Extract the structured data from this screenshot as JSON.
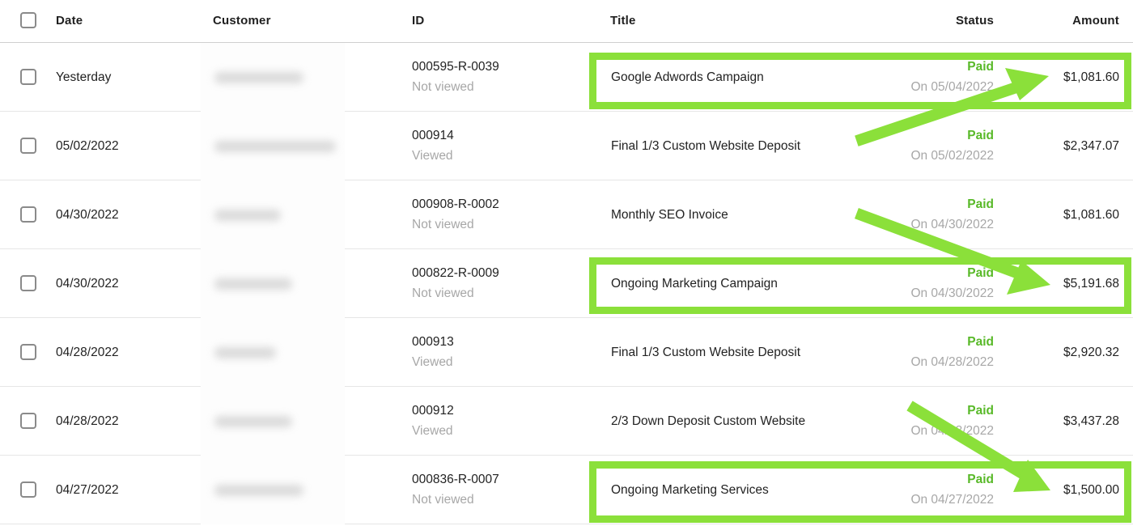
{
  "header": {
    "date": "Date",
    "customer": "Customer",
    "id": "ID",
    "title": "Title",
    "status": "Status",
    "amount": "Amount"
  },
  "rows": [
    {
      "date": "Yesterday",
      "id": "000595-R-0039",
      "viewed": "Not viewed",
      "title": "Google Adwords Campaign",
      "status": "Paid",
      "status_date": "On 05/04/2022",
      "amount": "$1,081.60"
    },
    {
      "date": "05/02/2022",
      "id": "000914",
      "viewed": "Viewed",
      "title": "Final 1/3 Custom Website Deposit",
      "status": "Paid",
      "status_date": "On 05/02/2022",
      "amount": "$2,347.07"
    },
    {
      "date": "04/30/2022",
      "id": "000908-R-0002",
      "viewed": "Not viewed",
      "title": "Monthly SEO Invoice",
      "status": "Paid",
      "status_date": "On 04/30/2022",
      "amount": "$1,081.60"
    },
    {
      "date": "04/30/2022",
      "id": "000822-R-0009",
      "viewed": "Not viewed",
      "title": "Ongoing Marketing Campaign",
      "status": "Paid",
      "status_date": "On 04/30/2022",
      "amount": "$5,191.68"
    },
    {
      "date": "04/28/2022",
      "id": "000913",
      "viewed": "Viewed",
      "title": "Final 1/3 Custom Website Deposit",
      "status": "Paid",
      "status_date": "On 04/28/2022",
      "amount": "$2,920.32"
    },
    {
      "date": "04/28/2022",
      "id": "000912",
      "viewed": "Viewed",
      "title": "2/3 Down Deposit Custom Website",
      "status": "Paid",
      "status_date": "On 04/28/2022",
      "amount": "$3,437.28"
    },
    {
      "date": "04/27/2022",
      "id": "000836-R-0007",
      "viewed": "Not viewed",
      "title": "Ongoing Marketing Services",
      "status": "Paid",
      "status_date": "On 04/27/2022",
      "amount": "$1,500.00"
    }
  ],
  "annotations": {
    "highlight_color": "#8be03a",
    "status_paid_color": "#58b928"
  }
}
